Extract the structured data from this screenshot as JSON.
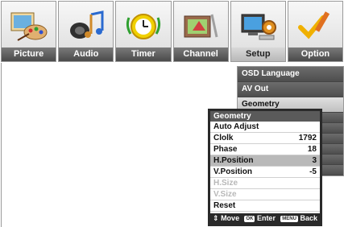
{
  "tabs": [
    {
      "label": "Picture",
      "icon": "palette-icon"
    },
    {
      "label": "Audio",
      "icon": "music-notes-icon"
    },
    {
      "label": "Timer",
      "icon": "clock-icon"
    },
    {
      "label": "Channel",
      "icon": "channel-icon"
    },
    {
      "label": "Setup",
      "icon": "setup-monitor-icon",
      "active": true
    },
    {
      "label": "Option",
      "icon": "pencil-check-icon"
    }
  ],
  "submenu": {
    "items": [
      "OSD Language",
      "AV Out",
      "Geometry"
    ],
    "selected": "Geometry"
  },
  "popup": {
    "title": "Geometry",
    "rows": [
      {
        "label": "Auto Adjust",
        "value": ""
      },
      {
        "label": "Clolk",
        "value": "1792"
      },
      {
        "label": "Phase",
        "value": "18"
      },
      {
        "label": "H.Position",
        "value": "3"
      },
      {
        "label": "V.Position",
        "value": "-5"
      },
      {
        "label": "H.Size",
        "value": ""
      },
      {
        "label": "V.Size",
        "value": ""
      },
      {
        "label": "Reset",
        "value": ""
      }
    ],
    "footer": {
      "move": "Move",
      "ok_badge": "OK",
      "enter": "Enter",
      "menu_badge": "MENU",
      "back": "Back"
    }
  }
}
